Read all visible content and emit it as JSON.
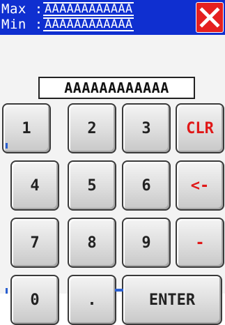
{
  "header": {
    "max_label": "Max :",
    "max_value": "AAAAAAAAAAAA",
    "min_label": "Min :",
    "min_value": "AAAAAAAAAAAA",
    "close_icon": "close-x-icon"
  },
  "display": {
    "value": "AAAAAAAAAAAA"
  },
  "keypad": {
    "keys": [
      "1",
      "2",
      "3",
      "CLR",
      "4",
      "5",
      "6",
      "<-",
      "7",
      "8",
      "9",
      "-",
      "0",
      ".",
      "ENTER"
    ]
  },
  "colors": {
    "header_bg": "#0f2fd0",
    "close_bg": "#e52020",
    "accent_red": "#e01818"
  }
}
